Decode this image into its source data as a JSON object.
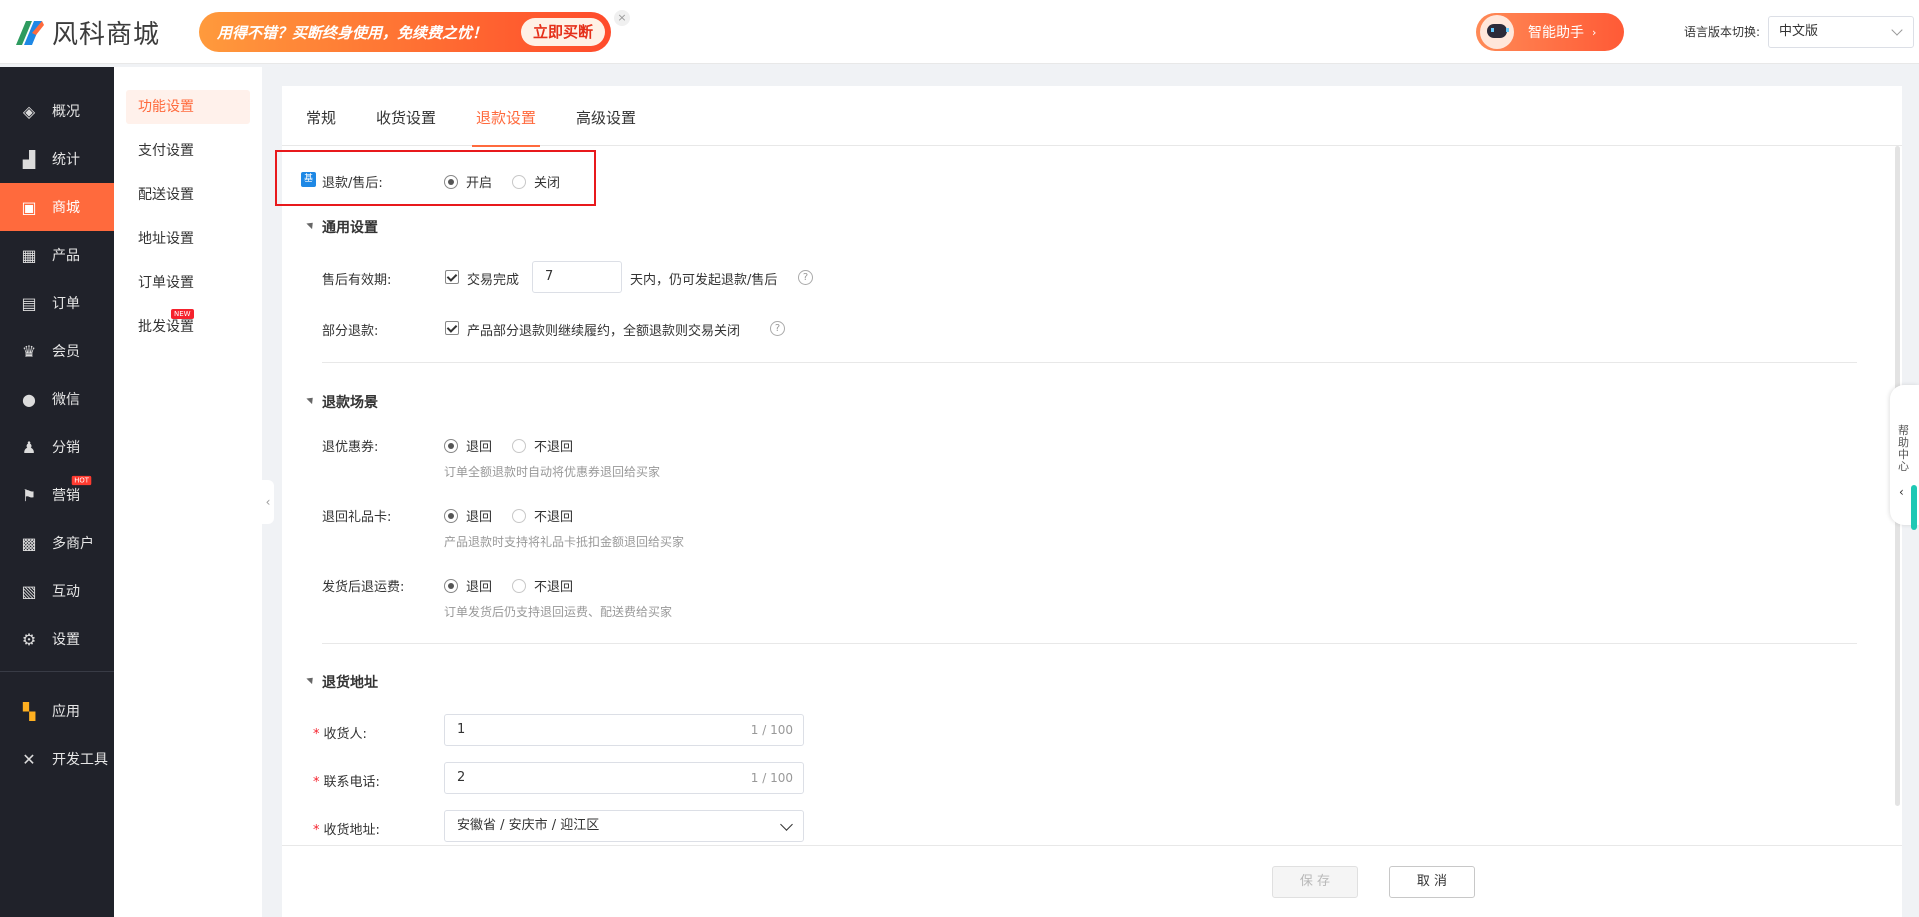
{
  "header": {
    "logo_text": "风科商城",
    "promo_text": "用得不错？买断终身使用，免续费之忧！",
    "promo_button": "立即买断",
    "promo_close": "×",
    "assistant_label": "智能助手",
    "assistant_arrow": "›",
    "lang_label": "语言版本切换:",
    "lang_value": "中文版"
  },
  "sidebar": {
    "items": [
      {
        "label": "概况",
        "icon": "layers-icon",
        "glyph": "◈"
      },
      {
        "label": "统计",
        "icon": "chart-icon",
        "glyph": "▟"
      },
      {
        "label": "商城",
        "icon": "shop-icon",
        "glyph": "▣"
      },
      {
        "label": "产品",
        "icon": "grid-icon",
        "glyph": "▦"
      },
      {
        "label": "订单",
        "icon": "order-icon",
        "glyph": "▤"
      },
      {
        "label": "会员",
        "icon": "crown-icon",
        "glyph": "♛"
      },
      {
        "label": "微信",
        "icon": "wechat-icon",
        "glyph": "●"
      },
      {
        "label": "分销",
        "icon": "users-icon",
        "glyph": "♟"
      },
      {
        "label": "营销",
        "icon": "flag-icon",
        "glyph": "⚑",
        "badge": "HOT"
      },
      {
        "label": "多商户",
        "icon": "merchant-icon",
        "glyph": "▩"
      },
      {
        "label": "互动",
        "icon": "interact-icon",
        "glyph": "▧"
      },
      {
        "label": "设置",
        "icon": "gear-icon",
        "glyph": "⚙"
      },
      {
        "label": "应用",
        "icon": "apps-icon",
        "glyph": "▚"
      },
      {
        "label": "开发工具",
        "icon": "tools-icon",
        "glyph": "✕"
      }
    ]
  },
  "subnav": {
    "items": [
      "功能设置",
      "支付设置",
      "配送设置",
      "地址设置",
      "订单设置",
      "批发设置"
    ],
    "new_badge": "NEW",
    "collapse_glyph": "‹"
  },
  "tabs": [
    "常规",
    "收货设置",
    "退款设置",
    "高级设置"
  ],
  "refund": {
    "base_badge": "基",
    "label": "退款/售后:",
    "options": [
      "开启",
      "关闭"
    ],
    "selected": "开启"
  },
  "general": {
    "title": "通用设置",
    "validity_label": "售后有效期:",
    "validity_check": "交易完成",
    "validity_days": "7",
    "validity_suffix": "天内，仍可发起退款/售后",
    "partial_label": "部分退款:",
    "partial_text": "产品部分退款则继续履约，全额退款则交易关闭",
    "help_glyph": "?"
  },
  "scenes": {
    "title": "退款场景",
    "rows": [
      {
        "label": "退优惠券:",
        "options": [
          "退回",
          "不退回"
        ],
        "selected": "退回",
        "hint": "订单全额退款时自动将优惠券退回给买家"
      },
      {
        "label": "退回礼品卡:",
        "options": [
          "退回",
          "不退回"
        ],
        "selected": "退回",
        "hint": "产品退款时支持将礼品卡抵扣金额退回给买家"
      },
      {
        "label": "发货后退运费:",
        "options": [
          "退回",
          "不退回"
        ],
        "selected": "退回",
        "hint": "订单发货后仍支持退回运费、配送费给买家"
      }
    ]
  },
  "address": {
    "title": "退货地址",
    "required_mark": "*",
    "receiver_label": "收货人:",
    "receiver_value": "1",
    "receiver_count": "1 / 100",
    "phone_label": "联系电话:",
    "phone_value": "2",
    "phone_count": "1 / 100",
    "addr_label": "收货地址:",
    "addr_value": "安徽省 / 安庆市 / 迎江区"
  },
  "footer": {
    "save": "保 存",
    "cancel": "取 消"
  },
  "help_center": {
    "text": "帮助中心",
    "arrow": "‹"
  },
  "colors": {
    "accent": "#ff6a3d",
    "sidebar_bg": "#20222a",
    "highlight_border": "#e8191c"
  }
}
